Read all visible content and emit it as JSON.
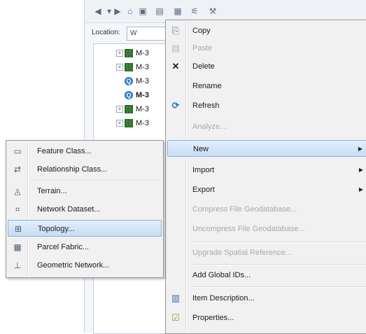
{
  "location": {
    "label": "Location:",
    "value": "W"
  },
  "tree": {
    "items": [
      {
        "label": "M-3",
        "type": "table",
        "expandable": true,
        "bold": false
      },
      {
        "label": "M-3",
        "type": "table",
        "expandable": true,
        "bold": false
      },
      {
        "label": "M-3",
        "type": "query",
        "expandable": false,
        "bold": false
      },
      {
        "label": "M-3",
        "type": "query",
        "expandable": false,
        "bold": true
      },
      {
        "label": "M-3",
        "type": "table",
        "expandable": true,
        "bold": false
      },
      {
        "label": "M-3",
        "type": "table",
        "expandable": true,
        "bold": false
      }
    ]
  },
  "context_menu": {
    "copy": "Copy",
    "paste": "Paste",
    "delete": "Delete",
    "rename": "Rename",
    "refresh": "Refresh",
    "analyze": "Analyze...",
    "new": "New",
    "import": "Import",
    "export": "Export",
    "compress": "Compress File Geodatabase...",
    "uncompress": "Uncompress File Geodatabase...",
    "upgrade": "Upgrade Spatial Reference...",
    "add_global_ids": "Add Global IDs...",
    "item_description": "Item Description...",
    "properties": "Properties..."
  },
  "new_submenu": {
    "feature_class": "Feature Class...",
    "relationship_class": "Relationship Class...",
    "terrain": "Terrain...",
    "network_dataset": "Network Dataset...",
    "topology": "Topology...",
    "parcel_fabric": "Parcel Fabric...",
    "geometric_network": "Geometric Network..."
  },
  "colors": {
    "highlight": "#c7dcf5",
    "highlight_border": "#8fb1d9",
    "disabled_text": "#a8a8a8"
  }
}
